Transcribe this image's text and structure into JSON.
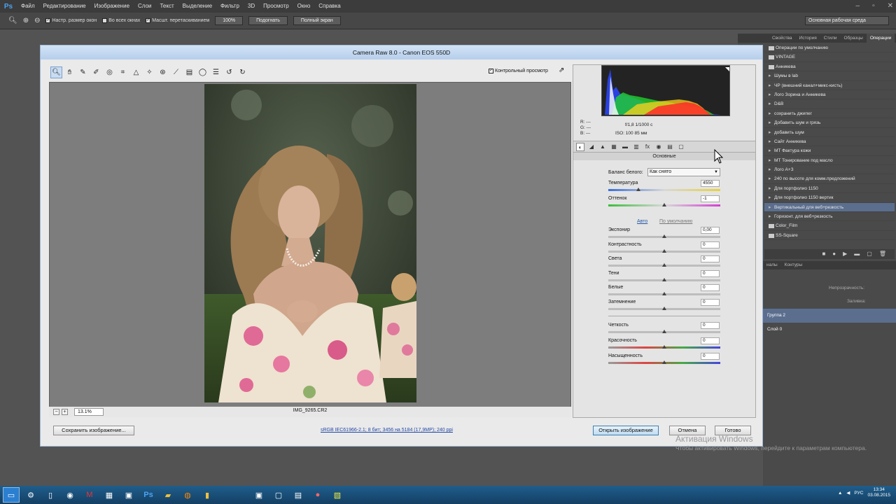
{
  "app": {
    "logo": "Ps"
  },
  "menu": [
    "Файл",
    "Редактирование",
    "Изображение",
    "Слои",
    "Текст",
    "Выделение",
    "Фильтр",
    "3D",
    "Просмотр",
    "Окно",
    "Справка"
  ],
  "options_bar": {
    "checks": [
      "Настр. размер окон",
      "Во всех окнах",
      "Масшт. перетаскиванием"
    ],
    "buttons": [
      "100%",
      "Подогнать",
      "Полный экран"
    ],
    "workspace": "Основная рабочая среда"
  },
  "actions_panel": {
    "tabs": [
      "Свойства",
      "История",
      "Стили",
      "Образцы",
      "Операции"
    ],
    "active_tab": "Операции",
    "items": [
      {
        "label": "Операции по умолчанию",
        "type": "folder"
      },
      {
        "label": "VINTAGE",
        "type": "folder"
      },
      {
        "label": "Анникева",
        "type": "folder"
      },
      {
        "label": "Шумы в lab",
        "type": "item"
      },
      {
        "label": "ЧР (внешний канал+микс-кисть)",
        "type": "item"
      },
      {
        "label": "Лого Зорина и Анникева",
        "type": "item"
      },
      {
        "label": "D&B",
        "type": "item"
      },
      {
        "label": "сохранить джипег",
        "type": "item"
      },
      {
        "label": "Добавить шум и грязь",
        "type": "item"
      },
      {
        "label": "добавить шум",
        "type": "item"
      },
      {
        "label": "Сайт Анникева",
        "type": "item"
      },
      {
        "label": "MT Фактура кожи",
        "type": "item"
      },
      {
        "label": "MT Тонирование под масло",
        "type": "item"
      },
      {
        "label": "Лого А+З",
        "type": "item"
      },
      {
        "label": "240 по высоте для комм.предложений",
        "type": "item"
      },
      {
        "label": "Для портфолио 1150",
        "type": "item"
      },
      {
        "label": "Для портфолио 1150 вертик",
        "type": "item"
      },
      {
        "label": "Вертикальный для веб+резкость",
        "type": "item",
        "selected": true
      },
      {
        "label": "Горизонт. для веб+резкость",
        "type": "item"
      },
      {
        "label": "Color_Film",
        "type": "folder"
      },
      {
        "label": "SS-Square",
        "type": "folder"
      }
    ]
  },
  "layers_panel": {
    "tabs": [
      "налы",
      "Контуры"
    ],
    "opacity_label": "Непрозрачность:",
    "fill_label": "Заливка:",
    "layers": [
      "Группа 2",
      "Слой 0"
    ]
  },
  "camera_raw": {
    "title": "Camera Raw 8.0  -  Canon EOS 550D",
    "preview_label": "Контрольный просмотр",
    "zoom": "13.1%",
    "filename": "IMG_9265.CR2",
    "rgb": [
      "R:  ---",
      "G:  ---",
      "B:  ---"
    ],
    "exif_line1": "f/1,8    1/1000 с",
    "exif_line2": "ISO: 100    85 мм",
    "section": "Основные",
    "wb_label": "Баланс белого:",
    "wb_value": "Как снято",
    "auto": "Авто",
    "default": "По умолчанию",
    "sliders": [
      {
        "label": "Температура",
        "value": "4550",
        "pos": 0.27
      },
      {
        "label": "Оттенок",
        "value": "-1",
        "pos": 0.5
      }
    ],
    "tone_sliders": [
      {
        "label": "Экспонир",
        "value": "0,00",
        "pos": 0.5
      },
      {
        "label": "Контрастность",
        "value": "0",
        "pos": 0.5
      },
      {
        "label": "Света",
        "value": "0",
        "pos": 0.5
      },
      {
        "label": "Тени",
        "value": "0",
        "pos": 0.5
      },
      {
        "label": "Белые",
        "value": "0",
        "pos": 0.5
      },
      {
        "label": "Затемнение",
        "value": "0",
        "pos": 0.5
      }
    ],
    "presence_sliders": [
      {
        "label": "Четкость",
        "value": "0",
        "pos": 0.5
      },
      {
        "label": "Красочность",
        "value": "0",
        "pos": 0.5
      },
      {
        "label": "Насыщенность",
        "value": "0",
        "pos": 0.5
      }
    ],
    "save_button": "Сохранить изображение...",
    "workflow": "sRGB IEC61966-2.1; 8 бит; 3456 на 5184 (17,9MP); 240 ppi",
    "open_button": "Открыть изображение",
    "cancel_button": "Отмена",
    "done_button": "Готово"
  },
  "activation": {
    "title": "Активация Windows",
    "text": "Чтобы активировать Windows, перейдите к параметрам компьютера."
  },
  "taskbar": {
    "lang": "РУС",
    "time": "13:34",
    "date": "03.08.2015"
  }
}
